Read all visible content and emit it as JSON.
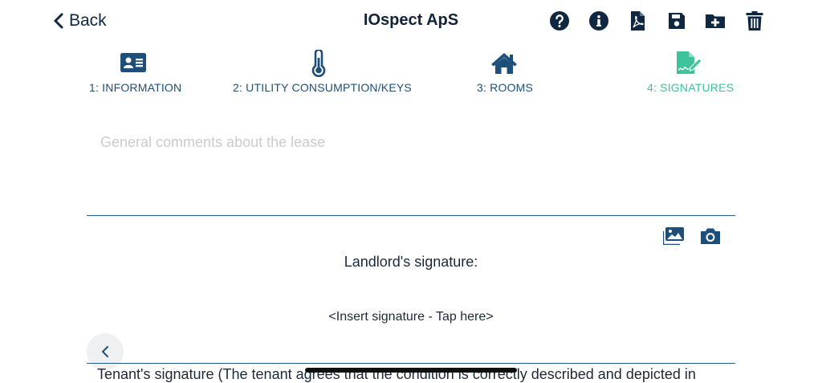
{
  "header": {
    "back_label": "Back",
    "title": "IOspect ApS",
    "icons": [
      "help-icon",
      "info-icon",
      "pdf-icon",
      "save-icon",
      "folder-add-icon",
      "trash-icon"
    ]
  },
  "tabs": [
    {
      "label": "1: INFORMATION",
      "icon": "id-card-icon",
      "active": false
    },
    {
      "label": "2: UTILITY CONSUMPTION/KEYS",
      "icon": "thermometer-icon",
      "active": false
    },
    {
      "label": "3: ROOMS",
      "icon": "home-icon",
      "active": false
    },
    {
      "label": "4: SIGNATURES",
      "icon": "signature-icon",
      "active": true
    }
  ],
  "comments": {
    "placeholder": "General comments about the lease",
    "value": ""
  },
  "media": {
    "icons": [
      "gallery-icon",
      "camera-icon"
    ]
  },
  "signature": {
    "landlord_label": "Landlord's signature:",
    "insert_label": "<Insert signature - Tap here>",
    "tenant_label": "Tenant's signature (The tenant agrees that the condition is correctly described and depicted in"
  },
  "colors": {
    "primary": "#1d4f7a",
    "active_tab": "#3cc39a",
    "header_icon": "#0f2740",
    "divider": "#2a5a86"
  }
}
